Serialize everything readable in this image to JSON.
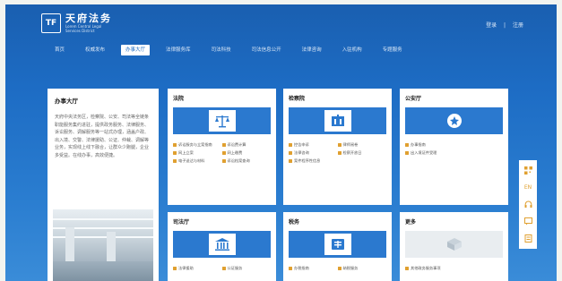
{
  "header": {
    "logo_mark": "TF",
    "logo_cn": "天府法务",
    "logo_en_line1": "Lorem Central Legal",
    "logo_en_line2": "Services District",
    "login": "登录",
    "separator": "|",
    "register": "注册"
  },
  "nav": {
    "items": [
      {
        "label": "首页",
        "active": false
      },
      {
        "label": "权威发布",
        "active": false
      },
      {
        "label": "办事大厅",
        "active": true
      },
      {
        "label": "法律服务库",
        "active": false
      },
      {
        "label": "司法科技",
        "active": false
      },
      {
        "label": "司法信息公开",
        "active": false
      },
      {
        "label": "法律咨询",
        "active": false
      },
      {
        "label": "入驻机构",
        "active": false
      },
      {
        "label": "专题服务",
        "active": false
      }
    ]
  },
  "intro": {
    "title": "办事大厅",
    "text": "天府中央法务区，检察院、公安、司法等全链条职能服务集约进驻，提供政务服务、法律服务、诉讼服务、调解服务等一站式办理，涵盖户政、出入境、交警、法律援助、公证、仲裁、调解等业务，实现线上线下融合，让群众少跑腿，企业多受益。在线办事，高效便捷。"
  },
  "cards": [
    {
      "title": "法院",
      "icon": "scales-icon",
      "links": [
        "诉讼服务与立案指南",
        "诉讼费计算",
        "网上立案",
        "网上缴费",
        "电子送达与材料",
        "诉讼档案查询"
      ]
    },
    {
      "title": "检察院",
      "icon": "procuratorate-building-icon",
      "links": [
        "控告申诉",
        "律师阅卷",
        "法律咨询",
        "检察开放日",
        "案件程序性信息"
      ]
    },
    {
      "title": "公安厅",
      "icon": "police-badge-icon",
      "links": [
        "办事指南",
        "出入境证件受理"
      ]
    },
    {
      "title": "司法厅",
      "icon": "courthouse-icon",
      "links": [
        "法律援助",
        "公证服务"
      ]
    },
    {
      "title": "税务",
      "icon": "tax-icon",
      "links": [
        "办税指南",
        "纳税服务"
      ]
    },
    {
      "title": "更多",
      "icon": "box-icon",
      "links": [
        "其他政务服务事项"
      ]
    }
  ],
  "side_tools": [
    "qrcode-icon",
    "english-icon",
    "headset-icon",
    "feedback-icon",
    "top-icon"
  ],
  "side_tool_labels": [
    "EN"
  ],
  "colors": {
    "primary": "#1d6cc4",
    "accent": "#e0a030",
    "card_bg": "#ffffff"
  }
}
